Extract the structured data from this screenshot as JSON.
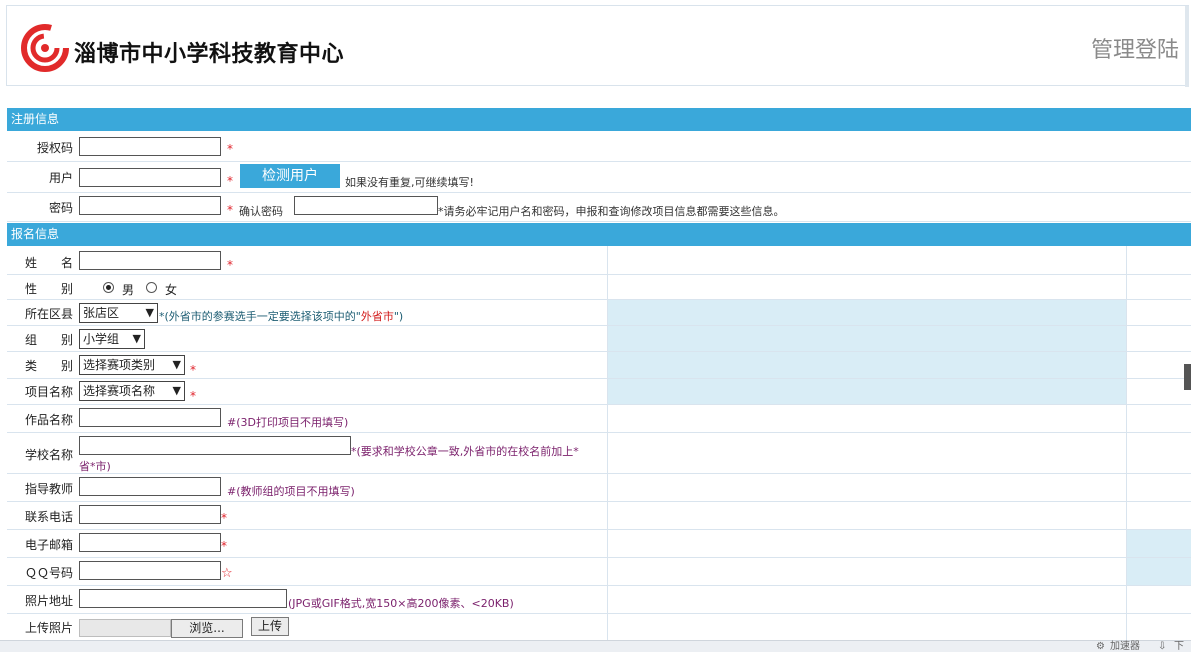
{
  "header": {
    "site_title": "淄博市中小学科技教育中心",
    "admin_login": "管理登陆"
  },
  "sections": {
    "registration": "注册信息",
    "signup": "报名信息"
  },
  "registration": {
    "auth_code_label": "授权码",
    "username_label": "用户",
    "check_user_button": "检测用户",
    "check_user_hint": "如果没有重复,可继续填写!",
    "password_label": "密码",
    "confirm_password_label": "确认密码",
    "password_hint": "*请务必牢记用户名和密码，申报和查询修改项目信息都需要这些信息。",
    "required_mark": "*"
  },
  "signup": {
    "name_label": "姓　　名",
    "gender_label": "性　　别",
    "gender_male": "男",
    "gender_female": "女",
    "district_label": "所在区县",
    "district_value": "张店区",
    "district_hint_prefix": "*(外省市的参赛选手一定要选择该项中的\"",
    "district_hint_highlight": "外省市",
    "district_hint_suffix": "\")",
    "group_label": "组　　别",
    "group_value": "小学组",
    "category_label": "类　　别",
    "category_value": "选择赛项类别",
    "project_label": "项目名称",
    "project_value": "选择赛项名称",
    "work_label": "作品名称",
    "work_hint": "#(3D打印项目不用填写)",
    "school_label": "学校名称",
    "school_hint_line1": "*(要求和学校公章一致,外省市的在校名前加上*",
    "school_hint_line2": "省*市)",
    "teacher_label": "指导教师",
    "teacher_hint": "#(教师组的项目不用填写)",
    "phone_label": "联系电话",
    "email_label": "电子邮箱",
    "qq_label": "ＱＱ号码",
    "photo_label": "照片地址",
    "photo_hint": "(JPG或GIF格式,宽150×高200像素、<20KB)",
    "upload_label": "上传照片",
    "browse_button": "浏览...",
    "upload_button": "上传",
    "required_mark": "*",
    "required_star": "☆"
  },
  "status_bar": {
    "accelerator": "加速器",
    "download": "下"
  },
  "colors": {
    "section_bar": "#3aa8da",
    "required": "#e0242c",
    "hint_purple": "#7a1f6b",
    "photo_area": "#d9edf6"
  }
}
